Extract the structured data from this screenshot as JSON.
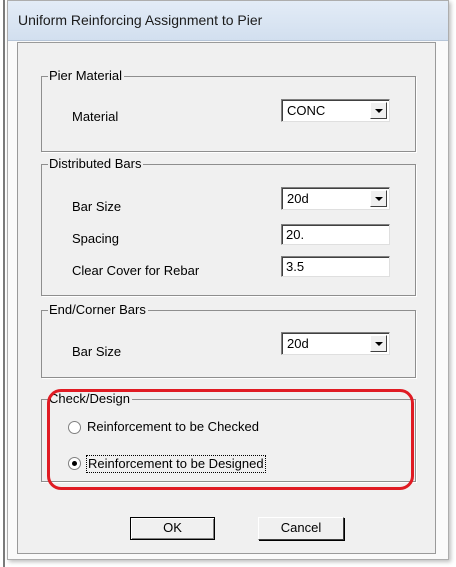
{
  "window": {
    "title": "Uniform Reinforcing Assignment to Pier"
  },
  "pier_material": {
    "legend": "Pier Material",
    "material_label": "Material",
    "material_value": "CONC"
  },
  "distributed_bars": {
    "legend": "Distributed Bars",
    "bar_size_label": "Bar Size",
    "bar_size_value": "20d",
    "spacing_label": "Spacing",
    "spacing_value": "20.",
    "clear_cover_label": "Clear Cover for Rebar",
    "clear_cover_value": "3.5"
  },
  "end_corner_bars": {
    "legend": "End/Corner Bars",
    "bar_size_label": "Bar Size",
    "bar_size_value": "20d"
  },
  "check_design": {
    "legend": "Check/Design",
    "options": [
      {
        "label": "Reinforcement to be Checked",
        "selected": false
      },
      {
        "label": "Reinforcement to be Designed",
        "selected": true
      }
    ]
  },
  "buttons": {
    "ok": "OK",
    "cancel": "Cancel"
  },
  "colors": {
    "highlight": "#e01b23",
    "titlebar": "#dbe6f3",
    "dialog_face": "#f0f0f0"
  },
  "icons": {
    "dropdown": "chevron-down-icon"
  }
}
